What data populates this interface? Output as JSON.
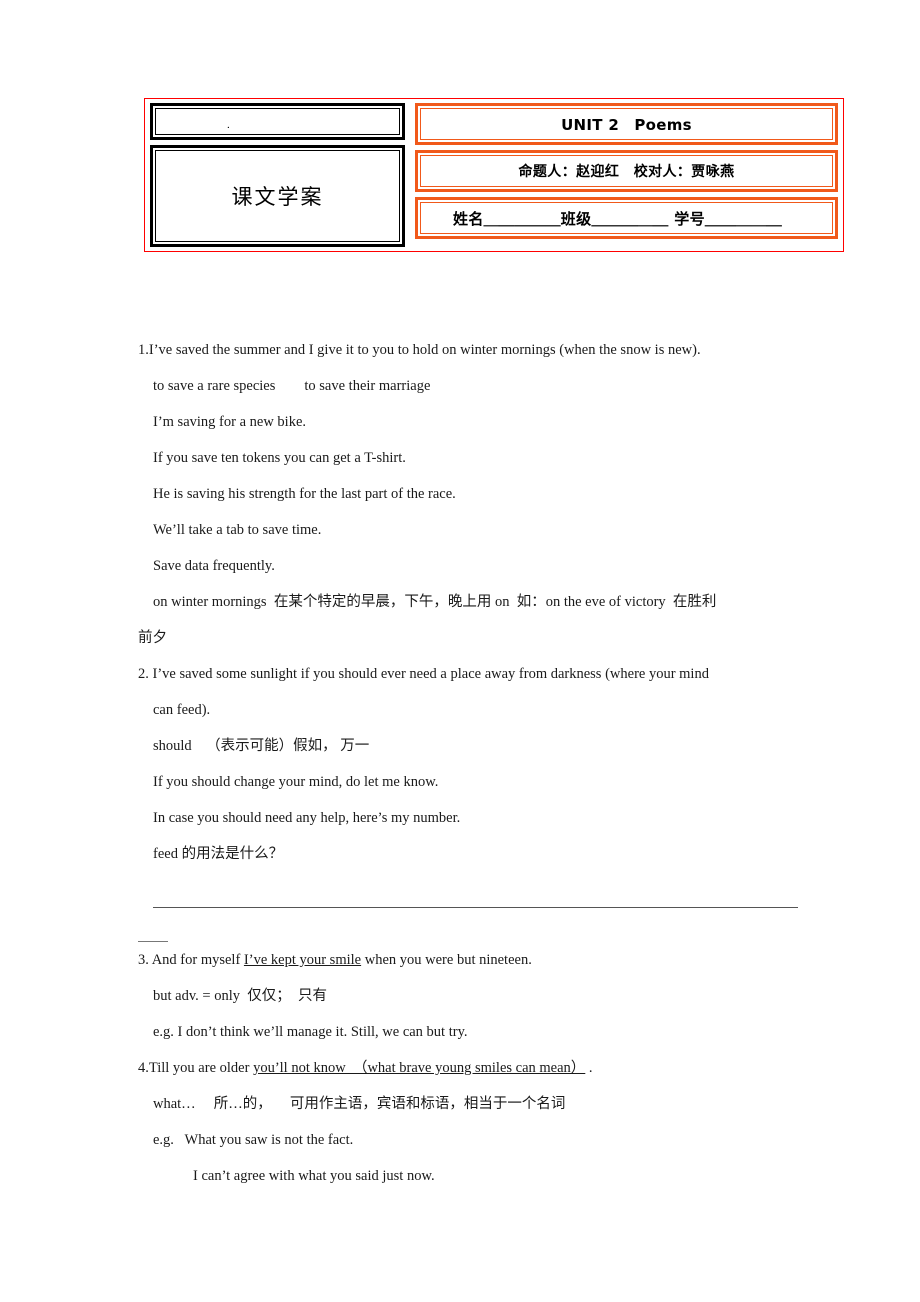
{
  "header": {
    "left_box_top_mark": ".",
    "left_box_title": "课文学案",
    "unit_title": "UNIT 2　Poems",
    "authors": "命题人：赵迎红　校对人：贾咏燕",
    "fields": "姓名＿＿＿＿＿班级＿＿＿＿＿ 学号＿＿＿＿＿"
  },
  "body": {
    "item1": {
      "sentence": "1.I’ve saved the summer and I give it to you to hold on winter mornings (when the snow is new).",
      "examples": [
        "to save a rare species　　to save their marriage",
        "I’m saving for a new bike.",
        "If you save ten tokens you can get a T-shirt.",
        "He is saving his strength for the last part of the race.",
        "We’ll take a tab to save time.",
        "Save data frequently."
      ],
      "note_a": "on winter mornings  在某个特定的早晨，下午，晚上用 on  如：on the eve of victory  在胜利",
      "note_b": "前夕"
    },
    "item2": {
      "sentence_line1": "2. I’ve saved some sunlight if you should ever need a place away from darkness (where your mind",
      "sentence_line2": "can feed).",
      "should_note": "should    （表示可能）假如， 万一",
      "examples": [
        "If you should change your mind, do let me know.",
        "In case you should need any help, here’s my number."
      ],
      "question": "feed 的用法是什么？"
    },
    "item3": {
      "prefix": "3. And for myself ",
      "underlined": "I’ve kept your smile",
      "suffix": " when you were but nineteen.",
      "note": "but adv. = only  仅仅；  只有",
      "example": "e.g. I don’t think we’ll manage it. Still, we can but try."
    },
    "item4": {
      "prefix": "4.Till you are older ",
      "underlined": "you’ll not know  （what brave young smiles can mean）",
      "suffix": " .",
      "note": "what…     所…的，     可用作主语，宾语和标语，相当于一个名词",
      "example_label": "e.g.   What you saw is not the fact.",
      "example_2": "I can’t agree with what you said just now."
    }
  }
}
